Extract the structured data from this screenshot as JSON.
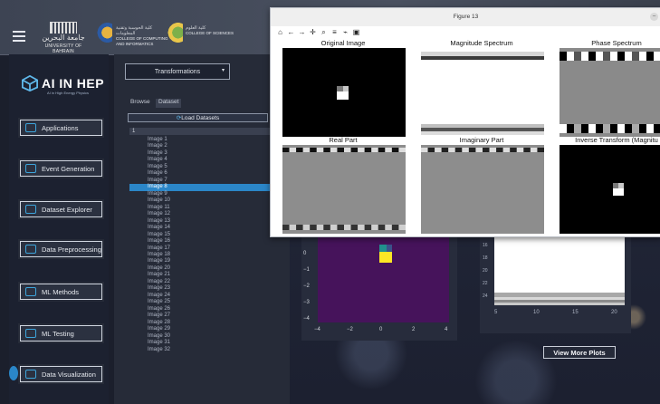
{
  "header": {
    "uni_arabic": "جامعة البحرين",
    "uni_name": "UNIVERSITY OF BAHRAIN",
    "college1_ar": "كلية الحوسبة وتقنية المعلومات",
    "college1_en": "COLLEGE OF COMPUTING AND INFORMATICS",
    "college2_ar": "كلية العلوم",
    "college2_en": "COLLEGE OF SCIENCES"
  },
  "brand": {
    "title": "AI IN HEP",
    "subtitle": "AI in High Energy Physics"
  },
  "nav": [
    "Applications",
    "Event Generation",
    "Dataset Explorer",
    "Data Preprocessing",
    "ML Methods",
    "ML Testing",
    "Data Visualization"
  ],
  "panel": {
    "dropdown": "Transformations",
    "tabs": [
      "Browse",
      "Dataset"
    ],
    "load_button": "Load Datasets",
    "list_header": "1",
    "items": [
      "Image 1",
      "Image 2",
      "Image 3",
      "Image 4",
      "Image 5",
      "Image 6",
      "Image 7",
      "Image 8",
      "Image 9",
      "Image 10",
      "Image 11",
      "Image 12",
      "Image 13",
      "Image 14",
      "Image 15",
      "Image 16",
      "Image 17",
      "Image 18",
      "Image 19",
      "Image 20",
      "Image 21",
      "Image 22",
      "Image 23",
      "Image 24",
      "Image 25",
      "Image 26",
      "Image 27",
      "Image 28",
      "Image 29",
      "Image 30",
      "Image 31",
      "Image 32"
    ],
    "selected_index": 7
  },
  "figure": {
    "title": "Figure 13",
    "subplots": [
      "Original Image",
      "Magnitude Spectrum",
      "Phase Spectrum",
      "Real Part",
      "Imaginary Part",
      "Inverse Transform (Magnitu"
    ]
  },
  "plots": {
    "left_y_ticks": [
      "0",
      "−1",
      "−2",
      "−3",
      "−4"
    ],
    "left_x_ticks": [
      "−4",
      "−2",
      "0",
      "2",
      "4"
    ],
    "right_y_ticks": [
      "16",
      "18",
      "20",
      "22",
      "24"
    ],
    "right_x_ticks": [
      "5",
      "10",
      "15",
      "20"
    ]
  },
  "view_more": "View More Plots",
  "colors": {
    "accent": "#2b86c8",
    "viridis_bg": "#46135b"
  }
}
